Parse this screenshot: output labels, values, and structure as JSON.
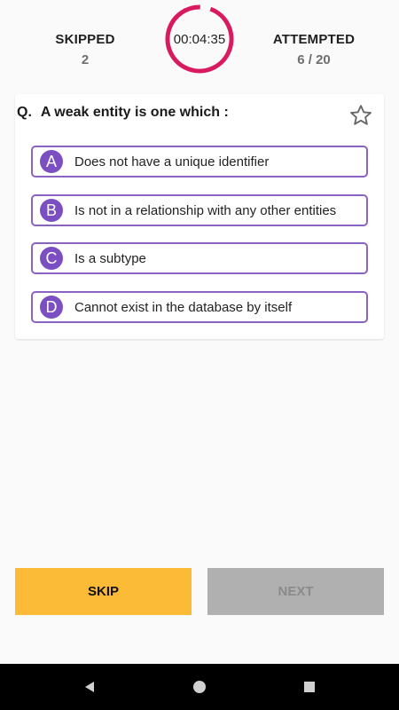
{
  "header": {
    "skipped": {
      "label": "SKIPPED",
      "value": "2"
    },
    "attempted": {
      "label": "ATTEMPTED",
      "value": "6 / 20"
    },
    "timer": {
      "time": "00:04:35",
      "color": "#d81b60"
    }
  },
  "question": {
    "prefix": "Q.",
    "text": "A weak entity is one which :",
    "bookmark_icon": "star-outline-icon"
  },
  "options": [
    {
      "letter": "A",
      "text": "Does not have a unique identifier"
    },
    {
      "letter": "B",
      "text": "Is not in a relationship with any other entities"
    },
    {
      "letter": "C",
      "text": "Is a subtype"
    },
    {
      "letter": "D",
      "text": "Cannot exist in the database by itself"
    }
  ],
  "buttons": {
    "skip": "SKIP",
    "next": "NEXT"
  },
  "colors": {
    "accent": "#7b4fc1",
    "skip_button": "#fbbb36",
    "next_button_disabled": "#b0b0b0",
    "timer_ring": "#d81b60"
  },
  "navbar": {
    "back_icon": "back-triangle-icon",
    "home_icon": "home-circle-icon",
    "recents_icon": "recents-square-icon"
  }
}
